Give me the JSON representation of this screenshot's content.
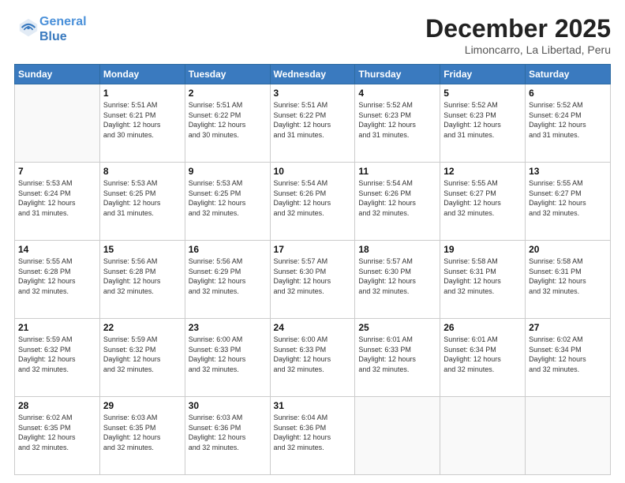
{
  "header": {
    "logo_line1": "General",
    "logo_line2": "Blue",
    "month": "December 2025",
    "location": "Limoncarro, La Libertad, Peru"
  },
  "weekdays": [
    "Sunday",
    "Monday",
    "Tuesday",
    "Wednesday",
    "Thursday",
    "Friday",
    "Saturday"
  ],
  "weeks": [
    [
      {
        "day": "",
        "info": ""
      },
      {
        "day": "1",
        "info": "Sunrise: 5:51 AM\nSunset: 6:21 PM\nDaylight: 12 hours\nand 30 minutes."
      },
      {
        "day": "2",
        "info": "Sunrise: 5:51 AM\nSunset: 6:22 PM\nDaylight: 12 hours\nand 30 minutes."
      },
      {
        "day": "3",
        "info": "Sunrise: 5:51 AM\nSunset: 6:22 PM\nDaylight: 12 hours\nand 31 minutes."
      },
      {
        "day": "4",
        "info": "Sunrise: 5:52 AM\nSunset: 6:23 PM\nDaylight: 12 hours\nand 31 minutes."
      },
      {
        "day": "5",
        "info": "Sunrise: 5:52 AM\nSunset: 6:23 PM\nDaylight: 12 hours\nand 31 minutes."
      },
      {
        "day": "6",
        "info": "Sunrise: 5:52 AM\nSunset: 6:24 PM\nDaylight: 12 hours\nand 31 minutes."
      }
    ],
    [
      {
        "day": "7",
        "info": "Sunrise: 5:53 AM\nSunset: 6:24 PM\nDaylight: 12 hours\nand 31 minutes."
      },
      {
        "day": "8",
        "info": "Sunrise: 5:53 AM\nSunset: 6:25 PM\nDaylight: 12 hours\nand 31 minutes."
      },
      {
        "day": "9",
        "info": "Sunrise: 5:53 AM\nSunset: 6:25 PM\nDaylight: 12 hours\nand 32 minutes."
      },
      {
        "day": "10",
        "info": "Sunrise: 5:54 AM\nSunset: 6:26 PM\nDaylight: 12 hours\nand 32 minutes."
      },
      {
        "day": "11",
        "info": "Sunrise: 5:54 AM\nSunset: 6:26 PM\nDaylight: 12 hours\nand 32 minutes."
      },
      {
        "day": "12",
        "info": "Sunrise: 5:55 AM\nSunset: 6:27 PM\nDaylight: 12 hours\nand 32 minutes."
      },
      {
        "day": "13",
        "info": "Sunrise: 5:55 AM\nSunset: 6:27 PM\nDaylight: 12 hours\nand 32 minutes."
      }
    ],
    [
      {
        "day": "14",
        "info": "Sunrise: 5:55 AM\nSunset: 6:28 PM\nDaylight: 12 hours\nand 32 minutes."
      },
      {
        "day": "15",
        "info": "Sunrise: 5:56 AM\nSunset: 6:28 PM\nDaylight: 12 hours\nand 32 minutes."
      },
      {
        "day": "16",
        "info": "Sunrise: 5:56 AM\nSunset: 6:29 PM\nDaylight: 12 hours\nand 32 minutes."
      },
      {
        "day": "17",
        "info": "Sunrise: 5:57 AM\nSunset: 6:30 PM\nDaylight: 12 hours\nand 32 minutes."
      },
      {
        "day": "18",
        "info": "Sunrise: 5:57 AM\nSunset: 6:30 PM\nDaylight: 12 hours\nand 32 minutes."
      },
      {
        "day": "19",
        "info": "Sunrise: 5:58 AM\nSunset: 6:31 PM\nDaylight: 12 hours\nand 32 minutes."
      },
      {
        "day": "20",
        "info": "Sunrise: 5:58 AM\nSunset: 6:31 PM\nDaylight: 12 hours\nand 32 minutes."
      }
    ],
    [
      {
        "day": "21",
        "info": "Sunrise: 5:59 AM\nSunset: 6:32 PM\nDaylight: 12 hours\nand 32 minutes."
      },
      {
        "day": "22",
        "info": "Sunrise: 5:59 AM\nSunset: 6:32 PM\nDaylight: 12 hours\nand 32 minutes."
      },
      {
        "day": "23",
        "info": "Sunrise: 6:00 AM\nSunset: 6:33 PM\nDaylight: 12 hours\nand 32 minutes."
      },
      {
        "day": "24",
        "info": "Sunrise: 6:00 AM\nSunset: 6:33 PM\nDaylight: 12 hours\nand 32 minutes."
      },
      {
        "day": "25",
        "info": "Sunrise: 6:01 AM\nSunset: 6:33 PM\nDaylight: 12 hours\nand 32 minutes."
      },
      {
        "day": "26",
        "info": "Sunrise: 6:01 AM\nSunset: 6:34 PM\nDaylight: 12 hours\nand 32 minutes."
      },
      {
        "day": "27",
        "info": "Sunrise: 6:02 AM\nSunset: 6:34 PM\nDaylight: 12 hours\nand 32 minutes."
      }
    ],
    [
      {
        "day": "28",
        "info": "Sunrise: 6:02 AM\nSunset: 6:35 PM\nDaylight: 12 hours\nand 32 minutes."
      },
      {
        "day": "29",
        "info": "Sunrise: 6:03 AM\nSunset: 6:35 PM\nDaylight: 12 hours\nand 32 minutes."
      },
      {
        "day": "30",
        "info": "Sunrise: 6:03 AM\nSunset: 6:36 PM\nDaylight: 12 hours\nand 32 minutes."
      },
      {
        "day": "31",
        "info": "Sunrise: 6:04 AM\nSunset: 6:36 PM\nDaylight: 12 hours\nand 32 minutes."
      },
      {
        "day": "",
        "info": ""
      },
      {
        "day": "",
        "info": ""
      },
      {
        "day": "",
        "info": ""
      }
    ]
  ]
}
